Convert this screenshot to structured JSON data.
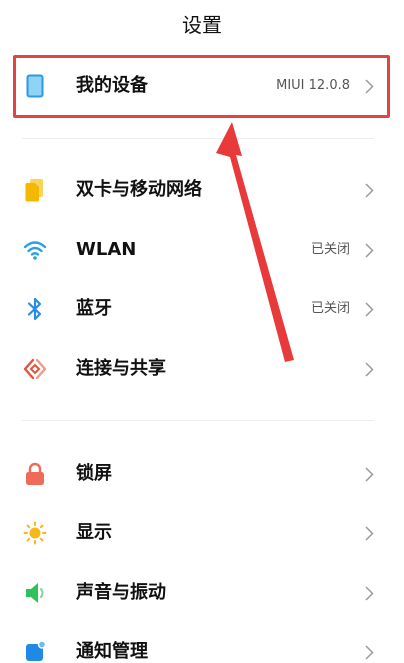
{
  "header": {
    "title": "设置"
  },
  "items": [
    {
      "id": "my-device",
      "label": "我的设备",
      "value": "MIUI 12.0.8"
    },
    {
      "id": "dual-sim",
      "label": "双卡与移动网络",
      "value": ""
    },
    {
      "id": "wlan",
      "label": "WLAN",
      "value": "已关闭"
    },
    {
      "id": "bluetooth",
      "label": "蓝牙",
      "value": "已关闭"
    },
    {
      "id": "connection-sharing",
      "label": "连接与共享",
      "value": ""
    },
    {
      "id": "lock-screen",
      "label": "锁屏",
      "value": ""
    },
    {
      "id": "display",
      "label": "显示",
      "value": ""
    },
    {
      "id": "sound-vibration",
      "label": "声音与振动",
      "value": ""
    },
    {
      "id": "notifications",
      "label": "通知管理",
      "value": ""
    }
  ],
  "colors": {
    "highlight": "#e04546",
    "sim": "#f5b800",
    "wlan": "#2aa0e6",
    "bluetooth": "#2a8be6",
    "connection": "#e0553b",
    "lock": "#ef6a57",
    "display": "#f6b81c",
    "sound": "#2fc15b",
    "notification": "#1f8ae6"
  }
}
